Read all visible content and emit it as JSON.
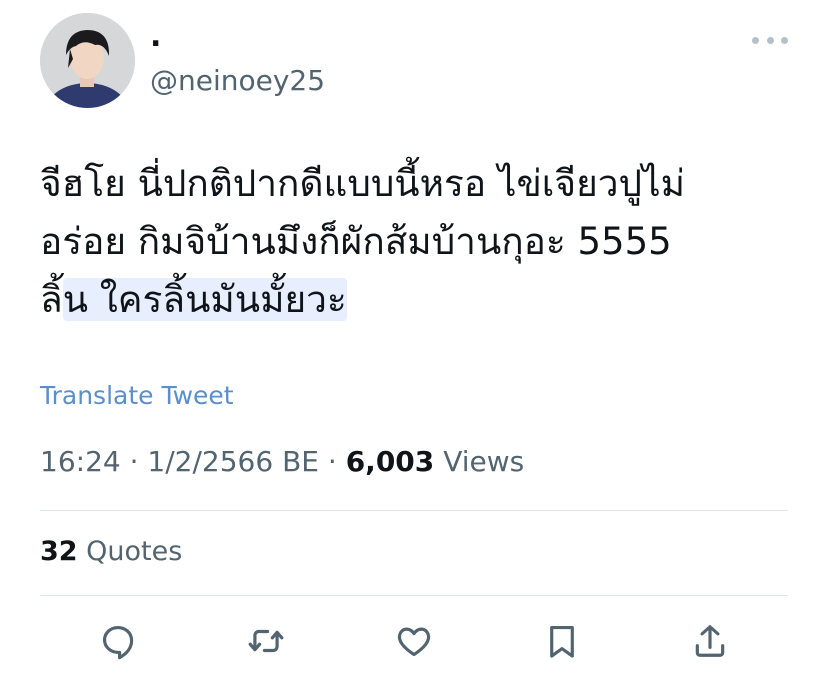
{
  "author": {
    "display_name": ".",
    "handle": "@neinoey25"
  },
  "more_icon": "more-horizontal-icon",
  "tweet": {
    "lines": [
      "จีฮโย นี่ปกติปากดีแบบนี้หรอ ไข่เจียวปูไม่",
      "อร่อย กิมจิบ้านมึงก็ผักส้มบ้านกุอะ 5555"
    ],
    "last_line_plain": "ลิ้",
    "last_line_highlight": "น ใครลิ้นมันมั้ยวะ"
  },
  "translate_label": "Translate Tweet",
  "meta": {
    "time": "16:24",
    "separator": "·",
    "date": "1/2/2566 BE",
    "views_count": "6,003",
    "views_label": "Views"
  },
  "stats": {
    "quotes_count": "32",
    "quotes_label": "Quotes"
  },
  "actions": [
    {
      "name": "reply-button",
      "icon": "reply-icon"
    },
    {
      "name": "retweet-button",
      "icon": "retweet-icon"
    },
    {
      "name": "like-button",
      "icon": "heart-icon"
    },
    {
      "name": "bookmark-button",
      "icon": "bookmark-icon"
    },
    {
      "name": "share-button",
      "icon": "share-icon"
    }
  ],
  "colors": {
    "text": "#0f1419",
    "secondary": "#536471",
    "link": "#5a8fcb",
    "highlight": "#e7efff",
    "divider": "#e1e6ea"
  }
}
